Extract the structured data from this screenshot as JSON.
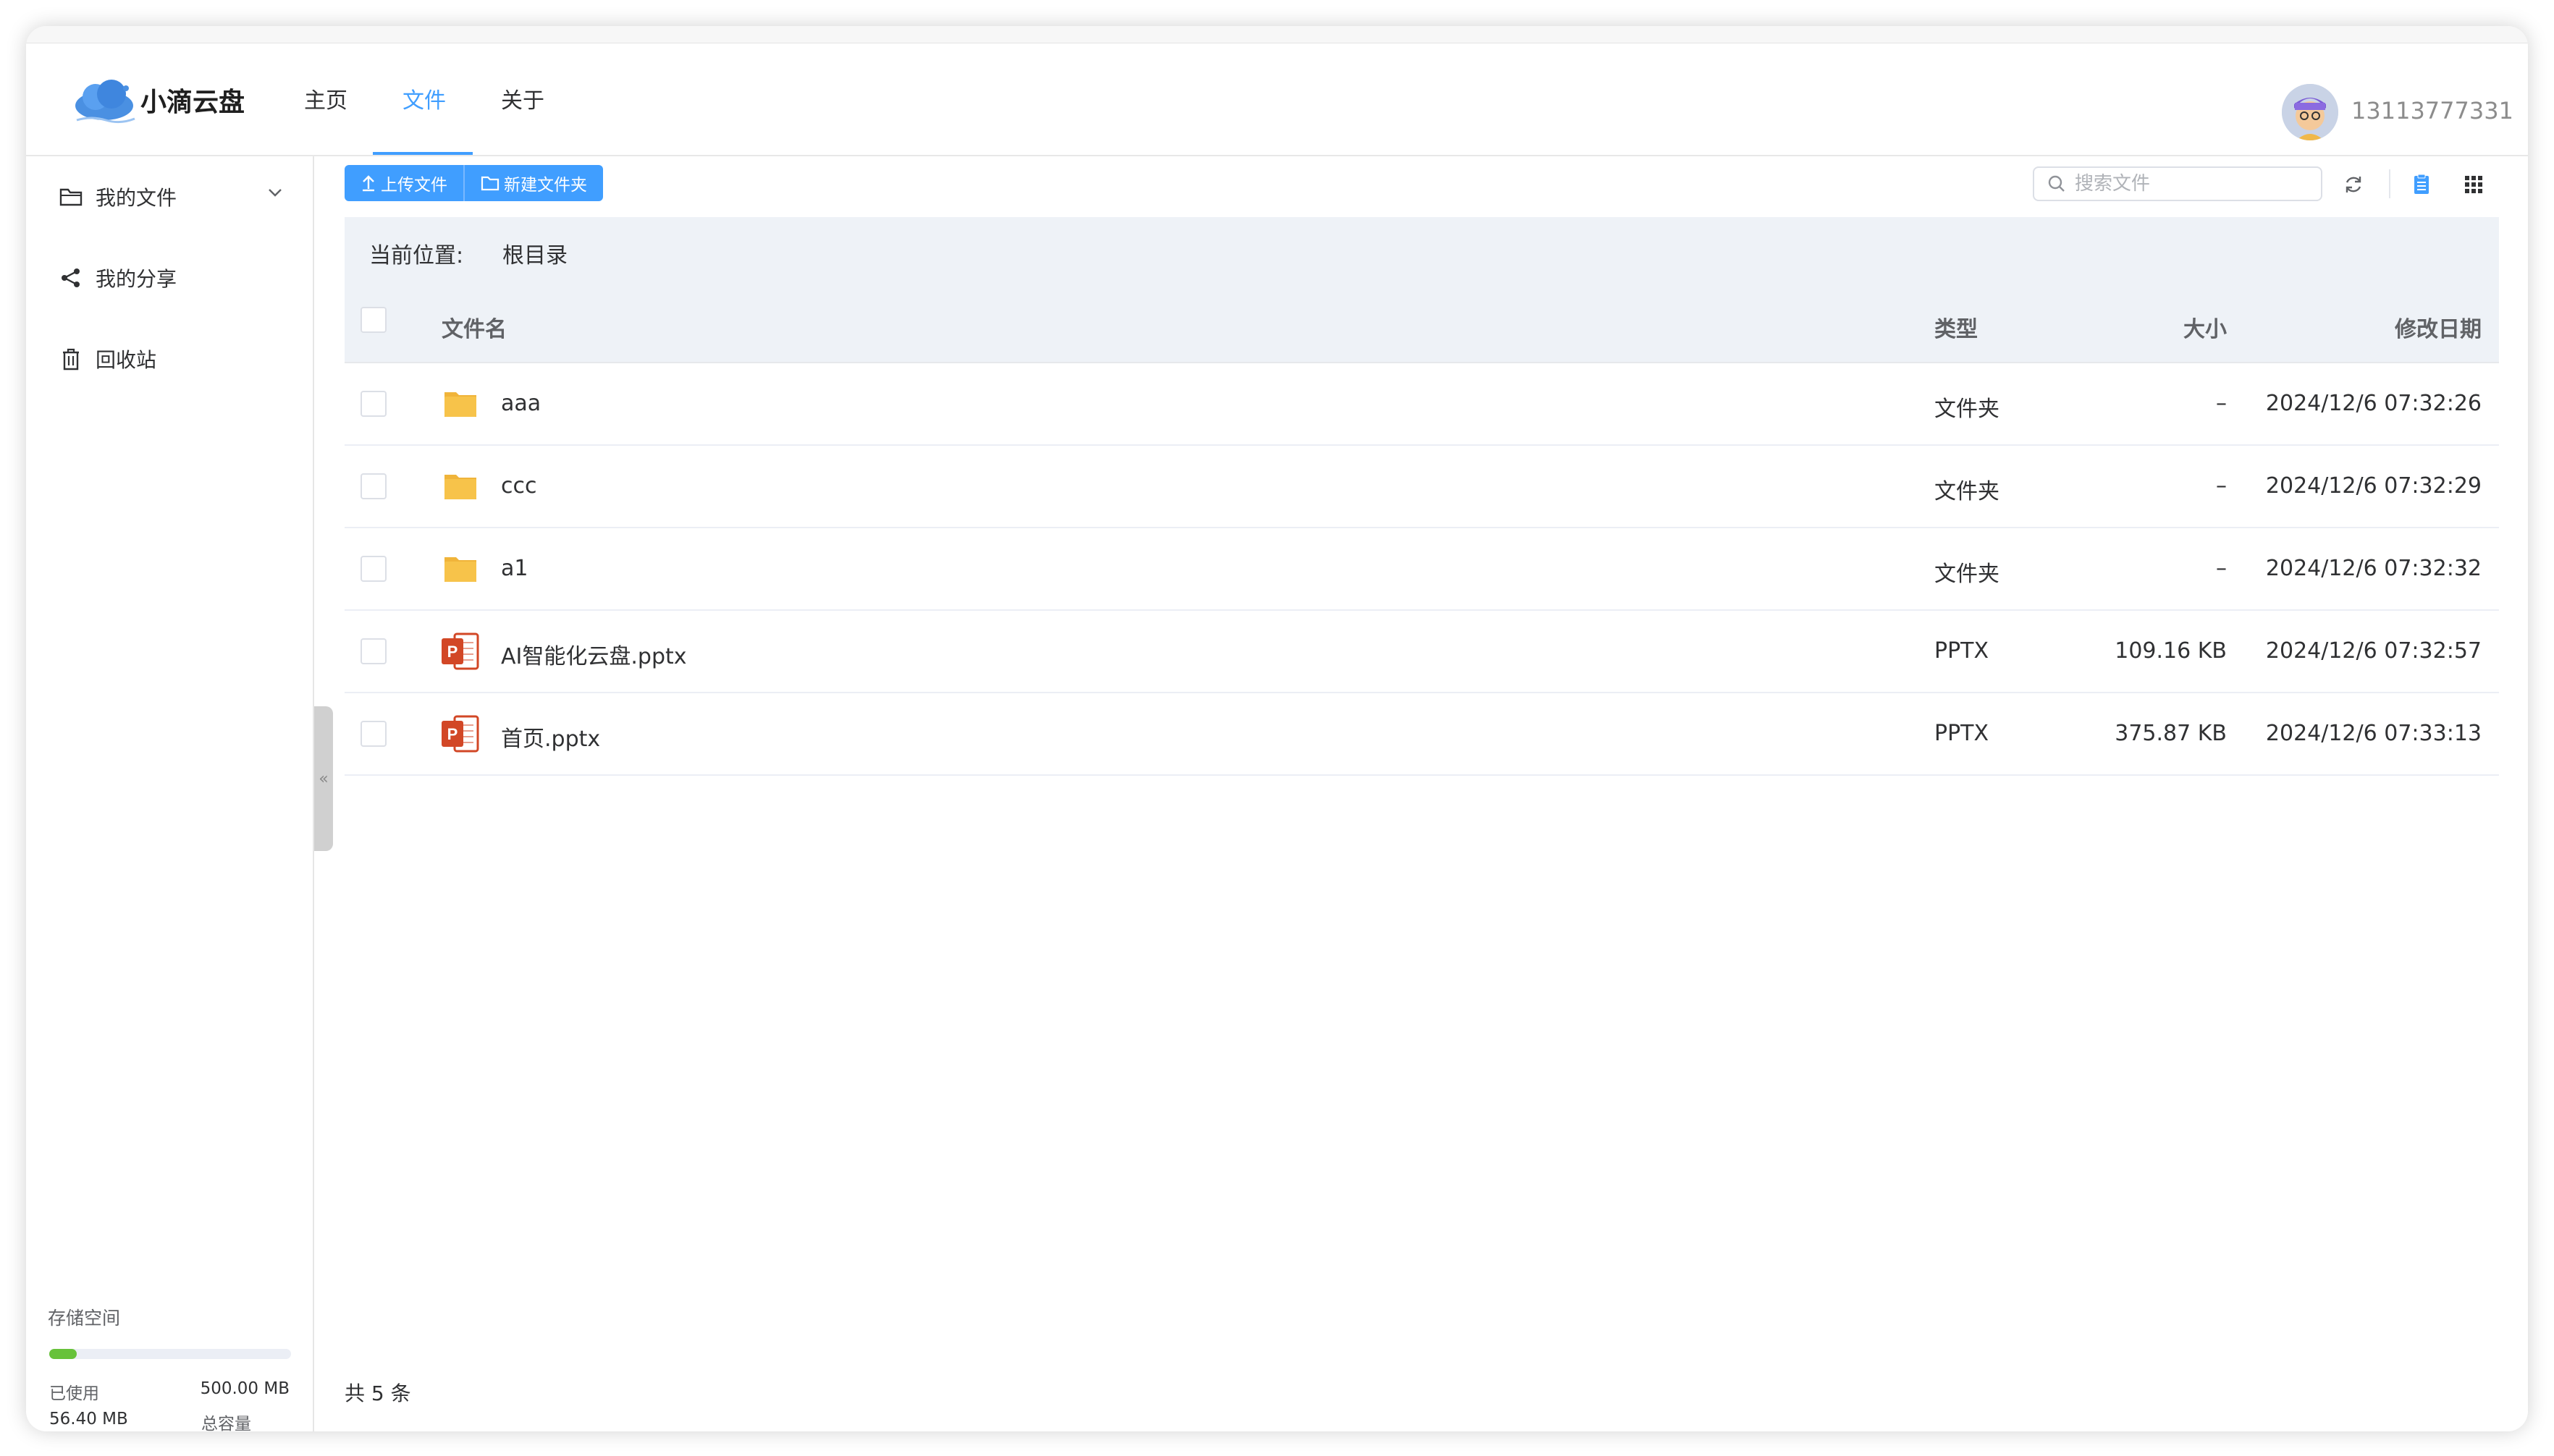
{
  "app": {
    "name": "小滴云盘"
  },
  "nav": {
    "items": [
      {
        "label": "主页"
      },
      {
        "label": "文件"
      },
      {
        "label": "关于"
      }
    ]
  },
  "user": {
    "phone": "13113777331"
  },
  "sidebar": {
    "items": [
      {
        "label": "我的文件"
      },
      {
        "label": "我的分享"
      },
      {
        "label": "回收站"
      }
    ],
    "storage": {
      "title": "存储空间",
      "used_label": "已使用",
      "used_value": "56.40 MB",
      "total_label": "总容量",
      "total_value": "500.00 MB",
      "used_fraction": 0.1128
    }
  },
  "toolbar": {
    "upload_label": "上传文件",
    "new_folder_label": "新建文件夹",
    "search_placeholder": "搜索文件"
  },
  "breadcrumb": {
    "label": "当前位置:",
    "path": "根目录"
  },
  "table": {
    "headers": {
      "name": "文件名",
      "type": "类型",
      "size": "大小",
      "modified": "修改日期"
    },
    "rows": [
      {
        "name": "aaa",
        "type": "文件夹",
        "size": "–",
        "modified": "2024/12/6 07:32:26",
        "icon": "folder-icon"
      },
      {
        "name": "ccc",
        "type": "文件夹",
        "size": "–",
        "modified": "2024/12/6 07:32:29",
        "icon": "folder-icon"
      },
      {
        "name": "a1",
        "type": "文件夹",
        "size": "–",
        "modified": "2024/12/6 07:32:32",
        "icon": "folder-icon"
      },
      {
        "name": "AI智能化云盘.pptx",
        "type": "PPTX",
        "size": "109.16 KB",
        "modified": "2024/12/6 07:32:57",
        "icon": "pptx-icon"
      },
      {
        "name": "首页.pptx",
        "type": "PPTX",
        "size": "375.87 KB",
        "modified": "2024/12/6 07:33:13",
        "icon": "pptx-icon"
      }
    ]
  },
  "footer": {
    "total": "共 5 条"
  },
  "colors": {
    "accent": "#409eff",
    "storage_bar": "#67c23a",
    "folder": "#f7c34a",
    "pptx": "#d24726"
  }
}
